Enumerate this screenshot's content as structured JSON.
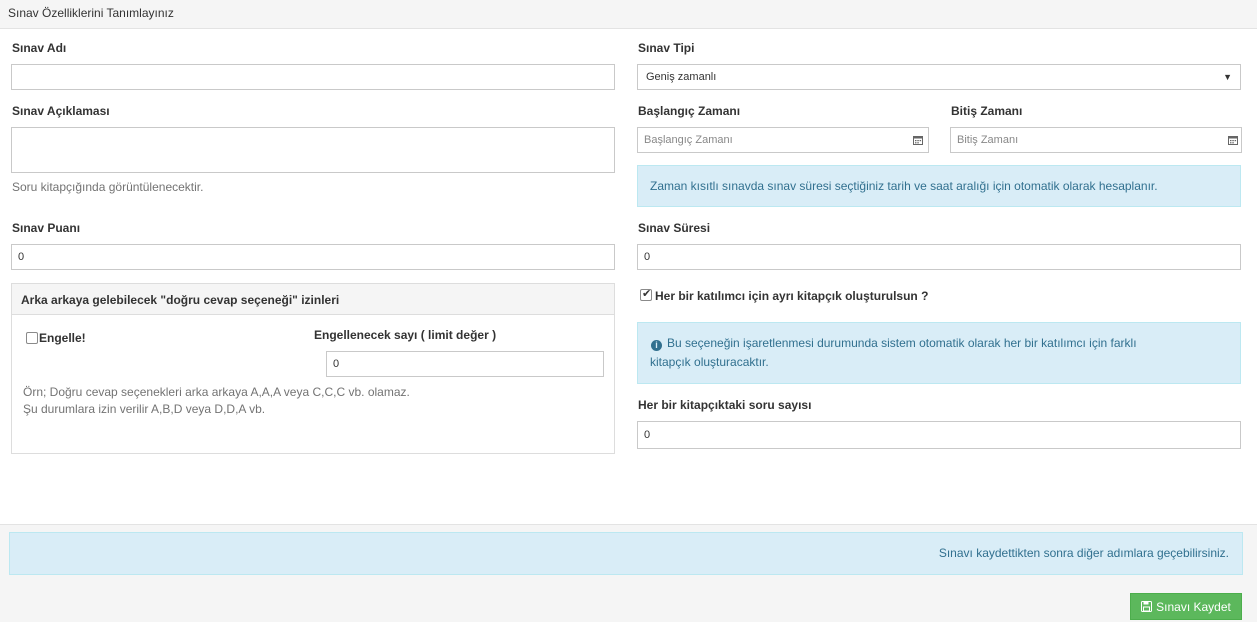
{
  "panel": {
    "title": "Sınav Özelliklerini Tanımlayınız"
  },
  "left": {
    "exam_name": {
      "label": "Sınav Adı",
      "value": "",
      "placeholder": ""
    },
    "exam_desc": {
      "label": "Sınav Açıklaması",
      "value": "",
      "help": "Soru kitapçığında görüntülenecektir."
    },
    "exam_score": {
      "label": "Sınav Puanı",
      "value": "0"
    },
    "consecutive": {
      "title": "Arka arkaya gelebilecek \"doğru cevap seçeneği\" izinleri",
      "block_label": "Engelle!",
      "block_checked": false,
      "limit_label": "Engellenecek sayı ( limit değer )",
      "limit_value": "0",
      "example_line1": "Örn; Doğru cevap seçenekleri arka arkaya A,A,A veya C,C,C vb. olamaz.",
      "example_line2": "Şu durumlara izin verilir A,B,D veya D,D,A vb."
    }
  },
  "right": {
    "exam_type": {
      "label": "Sınav Tipi",
      "selected": "Geniş zamanlı",
      "caret_icon": "caret-down-icon"
    },
    "start_time": {
      "label": "Başlangıç Zamanı",
      "placeholder": "Başlangıç Zamanı",
      "icon": "calendar-icon"
    },
    "end_time": {
      "label": "Bitiş Zamanı",
      "placeholder": "Bitiş Zamanı",
      "icon": "calendar-icon"
    },
    "time_info": "Zaman kısıtlı sınavda sınav süresi seçtiğiniz tarih ve saat aralığı için otomatik olarak hesaplanır.",
    "duration": {
      "label": "Sınav Süresi",
      "value": "0"
    },
    "separate_booklet": {
      "label": "Her bir katılımcı için ayrı kitapçık oluşturulsun ?",
      "checked": true
    },
    "booklet_info_line1": "Bu seçeneğin işaretlenmesi durumunda sistem otomatik olarak her bir katılımcı için farklı",
    "booklet_info_line2": "kitapçık oluşturacaktır.",
    "questions_per_booklet": {
      "label": "Her bir kitapçıktaki soru sayısı",
      "value": "0"
    }
  },
  "footer": {
    "notice": "Sınavı kaydettikten sonra diğer adımlara geçebilirsiniz.",
    "save_label": "Sınavı Kaydet",
    "save_icon": "floppy-disk-icon"
  },
  "colors": {
    "info_bg": "#d9edf7",
    "info_border": "#bce8f1",
    "info_text": "#31708f",
    "success": "#5cb85c"
  }
}
